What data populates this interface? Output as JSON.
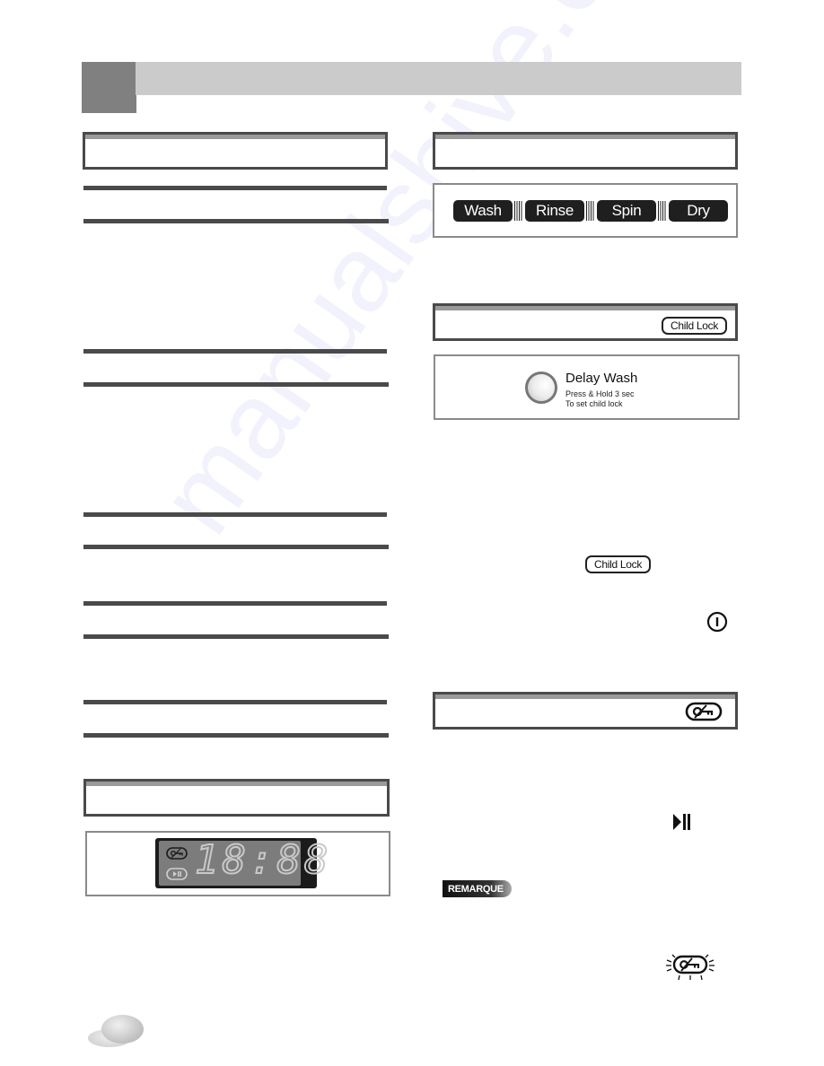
{
  "header": {
    "band_color": "#cbcbcb",
    "tab_color": "#808080"
  },
  "cycle_status": {
    "steps": [
      "Wash",
      "Rinse",
      "Spin",
      "Dry"
    ]
  },
  "child_lock": {
    "button_label": "Child Lock",
    "inline_button_label": "Child Lock"
  },
  "delay_wash": {
    "title": "Delay Wash",
    "line1": "Press & Hold 3 sec",
    "line2": "To set child lock"
  },
  "display": {
    "time": "18:88",
    "icons": [
      "child-lock-icon",
      "play-pause-icon"
    ]
  },
  "icons": {
    "power": "power-icon",
    "play_pause": "play-pause-icon",
    "lock": "child-lock-icon",
    "lock_blinking": "child-lock-blinking-icon"
  },
  "note": {
    "badge_label": "REMARQUE"
  },
  "watermark": {
    "text": "manualshive.com"
  }
}
